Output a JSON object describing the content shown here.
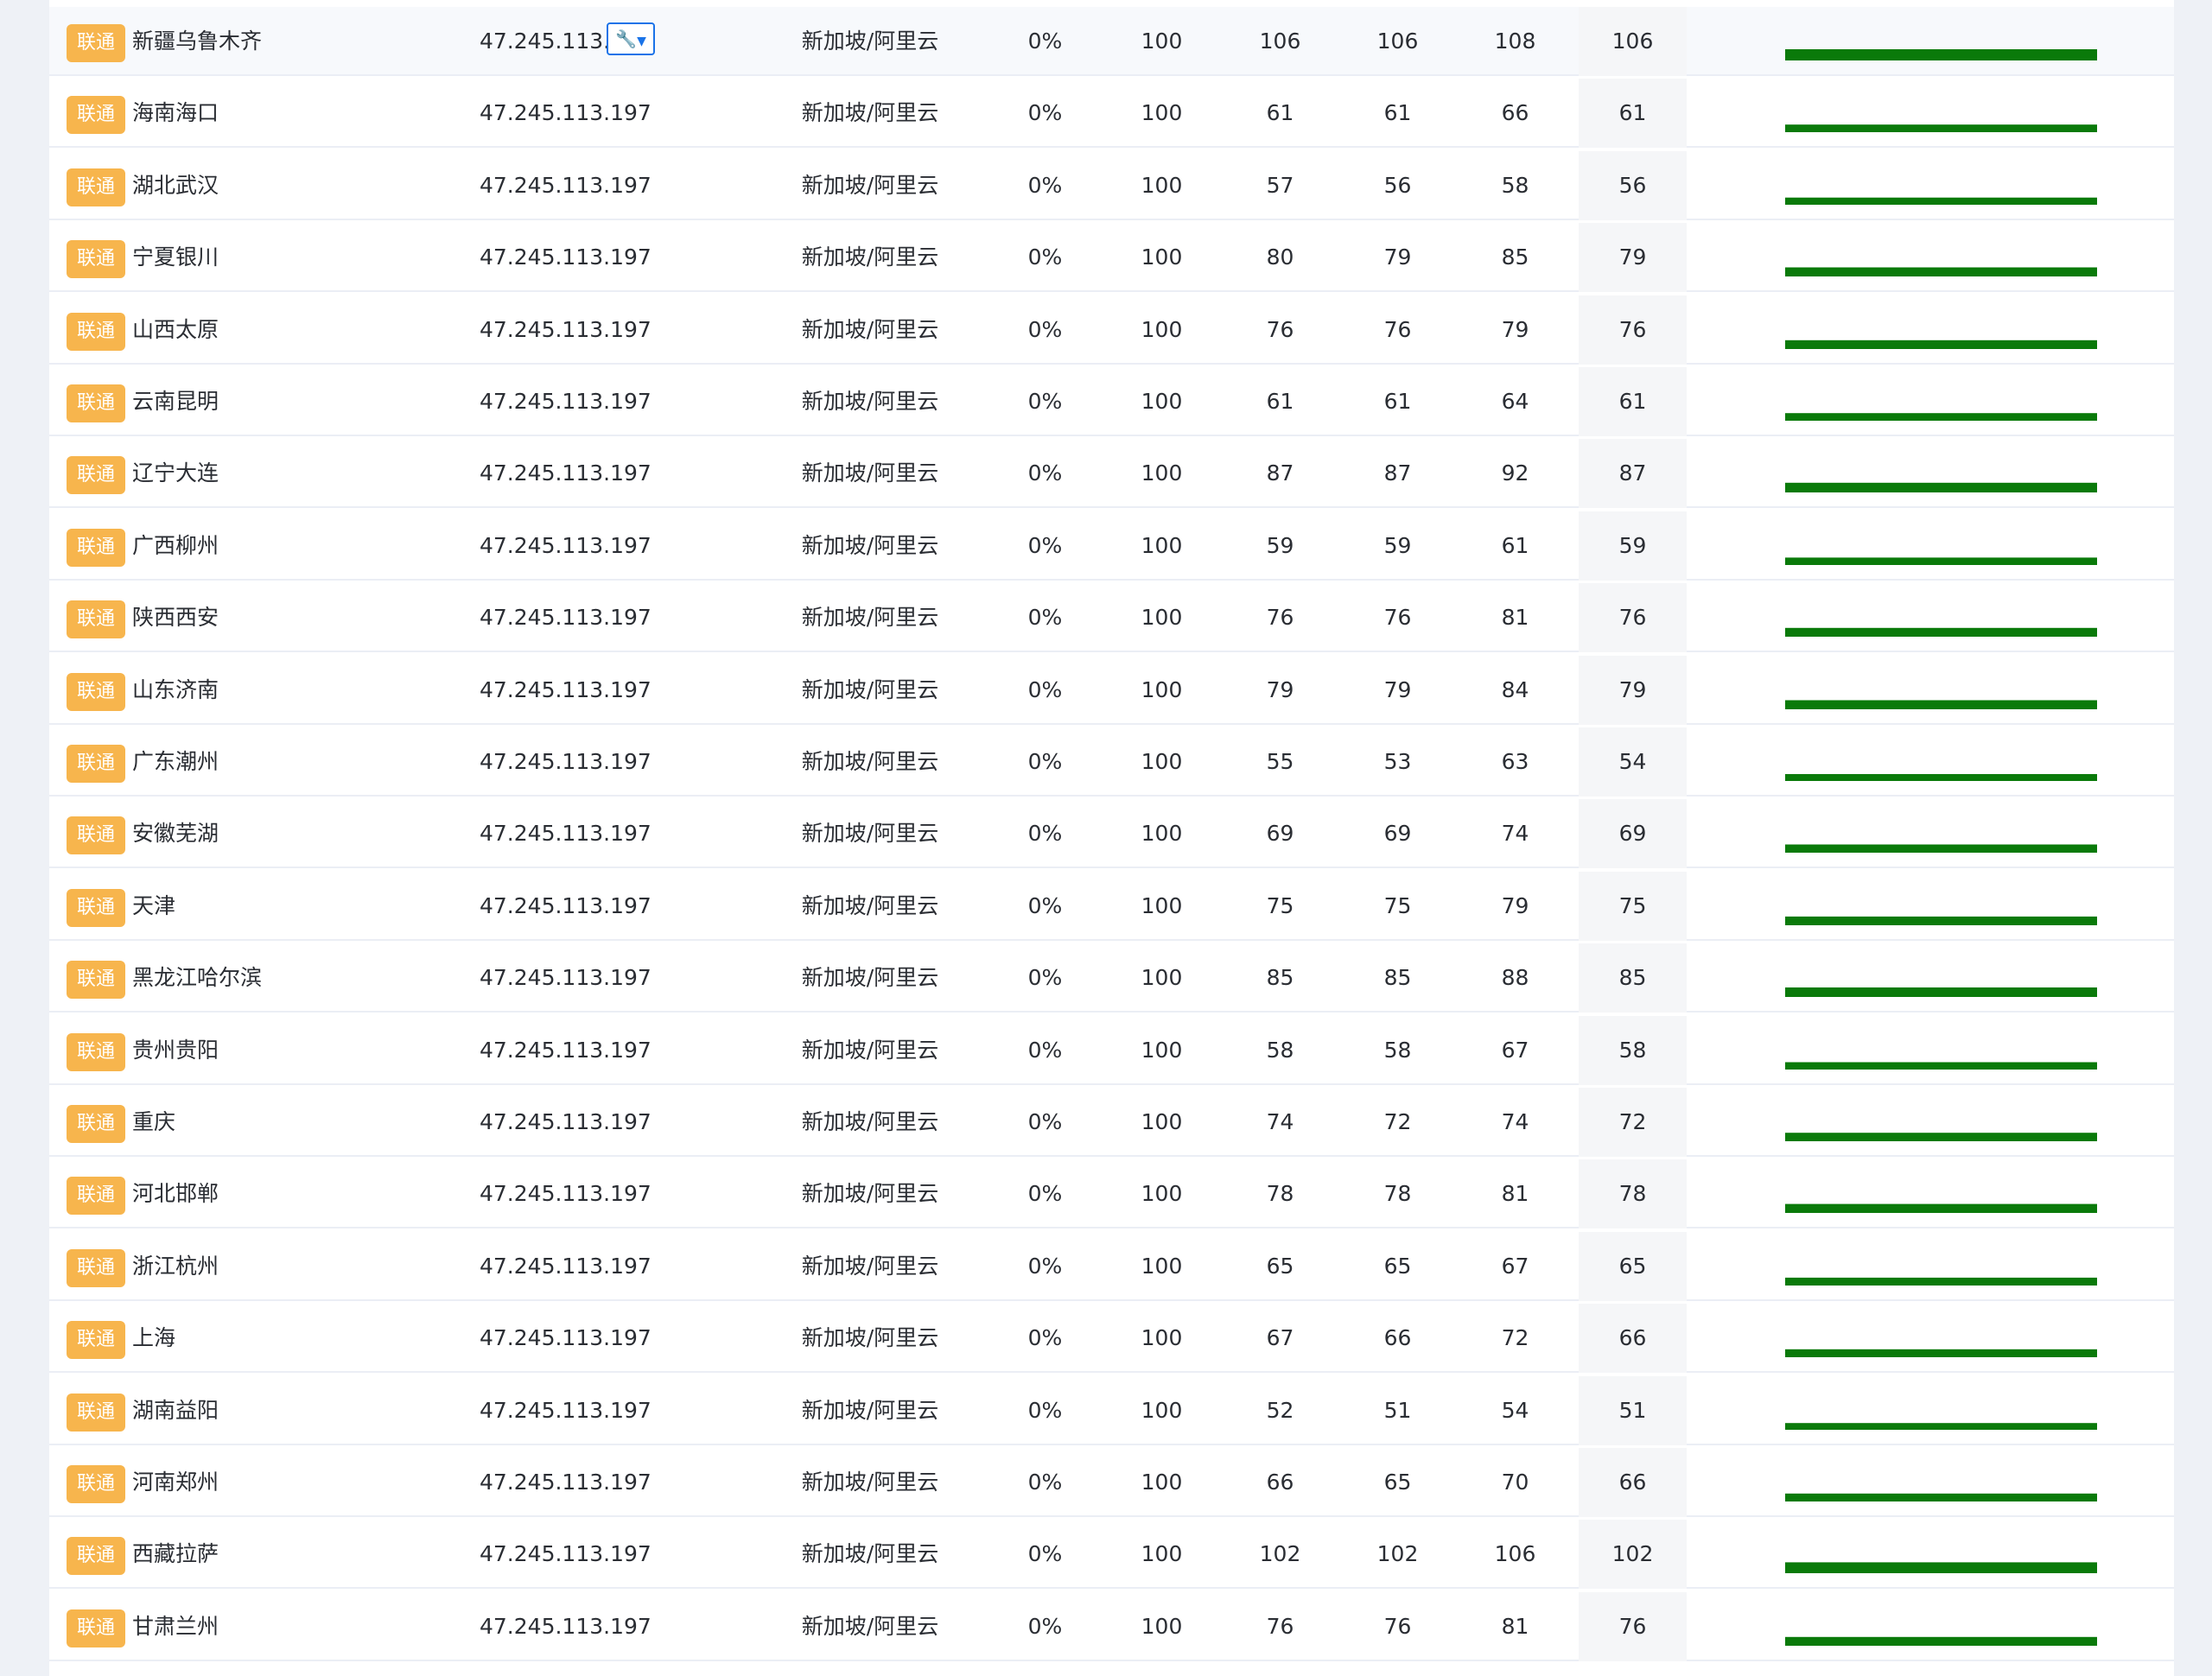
{
  "colors": {
    "badge": "#f7b54d",
    "spark": "#0a7a0a",
    "accent": "#1a73e8"
  },
  "rows": [
    {
      "isp": "联通",
      "node": "新疆乌鲁木齐",
      "ip": "47.245.113.197",
      "location": "新加坡/阿里云",
      "loss": "0%",
      "sent": "100",
      "last": "106",
      "avg": "106",
      "worst": "108",
      "best": "106",
      "spark_level": 1.0,
      "tool": true
    },
    {
      "isp": "联通",
      "node": "海南海口",
      "ip": "47.245.113.197",
      "location": "新加坡/阿里云",
      "loss": "0%",
      "sent": "100",
      "last": "61",
      "avg": "61",
      "worst": "66",
      "best": "61",
      "spark_level": 0.58
    },
    {
      "isp": "联通",
      "node": "湖北武汉",
      "ip": "47.245.113.197",
      "location": "新加坡/阿里云",
      "loss": "0%",
      "sent": "100",
      "last": "57",
      "avg": "56",
      "worst": "58",
      "best": "56",
      "spark_level": 0.53
    },
    {
      "isp": "联通",
      "node": "宁夏银川",
      "ip": "47.245.113.197",
      "location": "新加坡/阿里云",
      "loss": "0%",
      "sent": "100",
      "last": "80",
      "avg": "79",
      "worst": "85",
      "best": "79",
      "spark_level": 0.75
    },
    {
      "isp": "联通",
      "node": "山西太原",
      "ip": "47.245.113.197",
      "location": "新加坡/阿里云",
      "loss": "0%",
      "sent": "100",
      "last": "76",
      "avg": "76",
      "worst": "79",
      "best": "76",
      "spark_level": 0.72
    },
    {
      "isp": "联通",
      "node": "云南昆明",
      "ip": "47.245.113.197",
      "location": "新加坡/阿里云",
      "loss": "0%",
      "sent": "100",
      "last": "61",
      "avg": "61",
      "worst": "64",
      "best": "61",
      "spark_level": 0.58
    },
    {
      "isp": "联通",
      "node": "辽宁大连",
      "ip": "47.245.113.197",
      "location": "新加坡/阿里云",
      "loss": "0%",
      "sent": "100",
      "last": "87",
      "avg": "87",
      "worst": "92",
      "best": "87",
      "spark_level": 0.82
    },
    {
      "isp": "联通",
      "node": "广西柳州",
      "ip": "47.245.113.197",
      "location": "新加坡/阿里云",
      "loss": "0%",
      "sent": "100",
      "last": "59",
      "avg": "59",
      "worst": "61",
      "best": "59",
      "spark_level": 0.56
    },
    {
      "isp": "联通",
      "node": "陕西西安",
      "ip": "47.245.113.197",
      "location": "新加坡/阿里云",
      "loss": "0%",
      "sent": "100",
      "last": "76",
      "avg": "76",
      "worst": "81",
      "best": "76",
      "spark_level": 0.72
    },
    {
      "isp": "联通",
      "node": "山东济南",
      "ip": "47.245.113.197",
      "location": "新加坡/阿里云",
      "loss": "0%",
      "sent": "100",
      "last": "79",
      "avg": "79",
      "worst": "84",
      "best": "79",
      "spark_level": 0.75
    },
    {
      "isp": "联通",
      "node": "广东潮州",
      "ip": "47.245.113.197",
      "location": "新加坡/阿里云",
      "loss": "0%",
      "sent": "100",
      "last": "55",
      "avg": "53",
      "worst": "63",
      "best": "54",
      "spark_level": 0.5
    },
    {
      "isp": "联通",
      "node": "安徽芜湖",
      "ip": "47.245.113.197",
      "location": "新加坡/阿里云",
      "loss": "0%",
      "sent": "100",
      "last": "69",
      "avg": "69",
      "worst": "74",
      "best": "69",
      "spark_level": 0.65
    },
    {
      "isp": "联通",
      "node": "天津",
      "ip": "47.245.113.197",
      "location": "新加坡/阿里云",
      "loss": "0%",
      "sent": "100",
      "last": "75",
      "avg": "75",
      "worst": "79",
      "best": "75",
      "spark_level": 0.71
    },
    {
      "isp": "联通",
      "node": "黑龙江哈尔滨",
      "ip": "47.245.113.197",
      "location": "新加坡/阿里云",
      "loss": "0%",
      "sent": "100",
      "last": "85",
      "avg": "85",
      "worst": "88",
      "best": "85",
      "spark_level": 0.8
    },
    {
      "isp": "联通",
      "node": "贵州贵阳",
      "ip": "47.245.113.197",
      "location": "新加坡/阿里云",
      "loss": "0%",
      "sent": "100",
      "last": "58",
      "avg": "58",
      "worst": "67",
      "best": "58",
      "spark_level": 0.55
    },
    {
      "isp": "联通",
      "node": "重庆",
      "ip": "47.245.113.197",
      "location": "新加坡/阿里云",
      "loss": "0%",
      "sent": "100",
      "last": "74",
      "avg": "72",
      "worst": "74",
      "best": "72",
      "spark_level": 0.68
    },
    {
      "isp": "联通",
      "node": "河北邯郸",
      "ip": "47.245.113.197",
      "location": "新加坡/阿里云",
      "loss": "0%",
      "sent": "100",
      "last": "78",
      "avg": "78",
      "worst": "81",
      "best": "78",
      "spark_level": 0.74
    },
    {
      "isp": "联通",
      "node": "浙江杭州",
      "ip": "47.245.113.197",
      "location": "新加坡/阿里云",
      "loss": "0%",
      "sent": "100",
      "last": "65",
      "avg": "65",
      "worst": "67",
      "best": "65",
      "spark_level": 0.61
    },
    {
      "isp": "联通",
      "node": "上海",
      "ip": "47.245.113.197",
      "location": "新加坡/阿里云",
      "loss": "0%",
      "sent": "100",
      "last": "67",
      "avg": "66",
      "worst": "72",
      "best": "66",
      "spark_level": 0.62
    },
    {
      "isp": "联通",
      "node": "湖南益阳",
      "ip": "47.245.113.197",
      "location": "新加坡/阿里云",
      "loss": "0%",
      "sent": "100",
      "last": "52",
      "avg": "51",
      "worst": "54",
      "best": "51",
      "spark_level": 0.48
    },
    {
      "isp": "联通",
      "node": "河南郑州",
      "ip": "47.245.113.197",
      "location": "新加坡/阿里云",
      "loss": "0%",
      "sent": "100",
      "last": "66",
      "avg": "65",
      "worst": "70",
      "best": "66",
      "spark_level": 0.62
    },
    {
      "isp": "联通",
      "node": "西藏拉萨",
      "ip": "47.245.113.197",
      "location": "新加坡/阿里云",
      "loss": "0%",
      "sent": "100",
      "last": "102",
      "avg": "102",
      "worst": "106",
      "best": "102",
      "spark_level": 0.96
    },
    {
      "isp": "联通",
      "node": "甘肃兰州",
      "ip": "47.245.113.197",
      "location": "新加坡/阿里云",
      "loss": "0%",
      "sent": "100",
      "last": "76",
      "avg": "76",
      "worst": "81",
      "best": "76",
      "spark_level": 0.72
    }
  ]
}
